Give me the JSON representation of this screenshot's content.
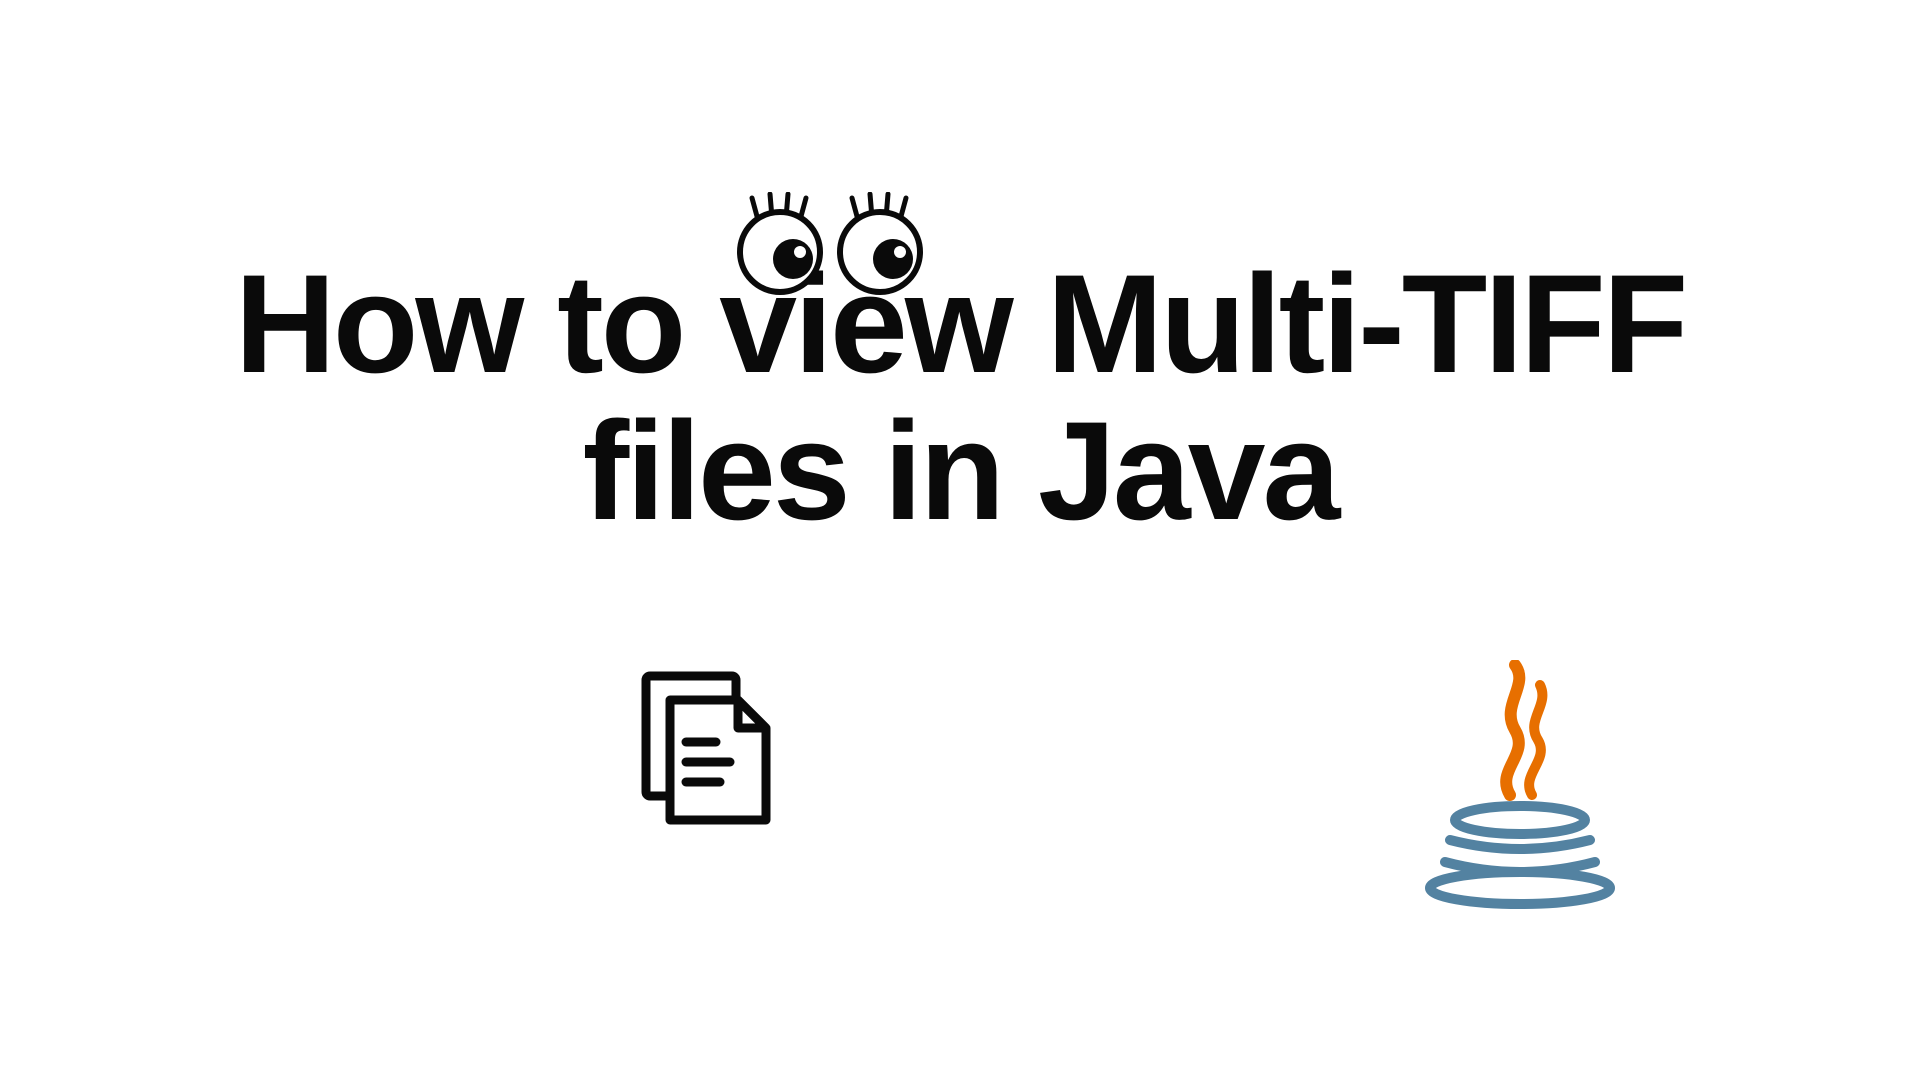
{
  "title": {
    "line1": "How to view Multi-TIFF",
    "line2": "files in Java"
  },
  "icons": {
    "eyes": "eyes-icon",
    "files": "files-icon",
    "java": "java-logo-icon"
  },
  "colors": {
    "text": "#0a0a0a",
    "javaOrange": "#e76f00",
    "javaBlue": "#5382a1"
  }
}
